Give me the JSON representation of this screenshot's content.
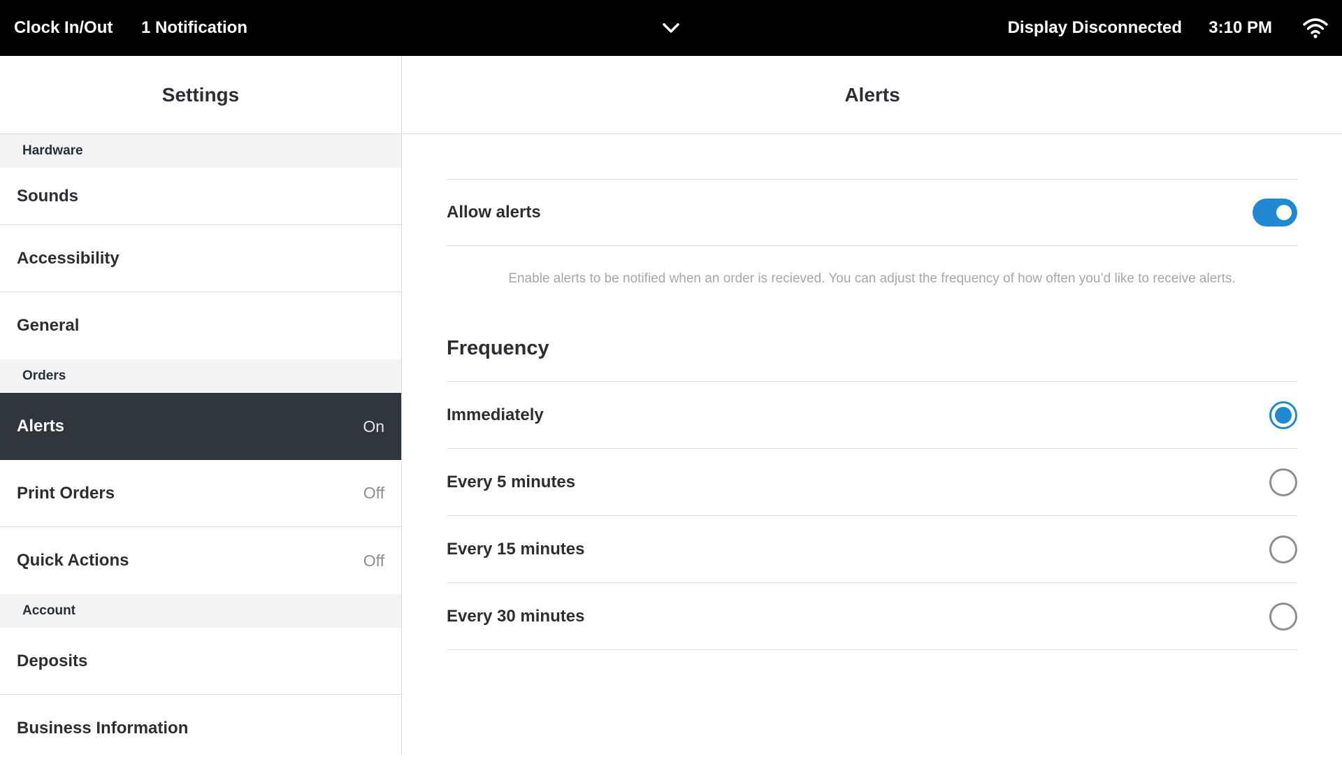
{
  "topbar": {
    "clock": "Clock In/Out",
    "notifications": "1 Notification",
    "display_status": "Display Disconnected",
    "time": "3:10 PM",
    "chevron_icon": "chevron-down-icon",
    "wifi_icon": "wifi-icon"
  },
  "sidebar": {
    "title": "Settings",
    "sections": {
      "hardware": "Hardware",
      "orders": "Orders",
      "account": "Account"
    },
    "items": {
      "sounds": "Sounds",
      "accessibility": "Accessibility",
      "general": "General",
      "alerts": {
        "label": "Alerts",
        "value": "On"
      },
      "print_orders": {
        "label": "Print Orders",
        "value": "Off"
      },
      "quick_actions": {
        "label": "Quick Actions",
        "value": "Off"
      },
      "deposits": "Deposits",
      "business_information": "Business Information"
    }
  },
  "main": {
    "title": "Alerts",
    "allow_alerts": {
      "label": "Allow alerts",
      "enabled": true
    },
    "description": "Enable alerts to be notified when an order is recieved. You can adjust the frequency of how often you’d like to receive alerts.",
    "frequency": {
      "title": "Frequency",
      "options": [
        "Immediately",
        "Every 5 minutes",
        "Every 15 minutes",
        "Every 30 minutes"
      ],
      "selected": "Immediately"
    }
  },
  "colors": {
    "accent": "#1f8ad1",
    "topbar": "#000000",
    "active_item": "#30363d"
  }
}
